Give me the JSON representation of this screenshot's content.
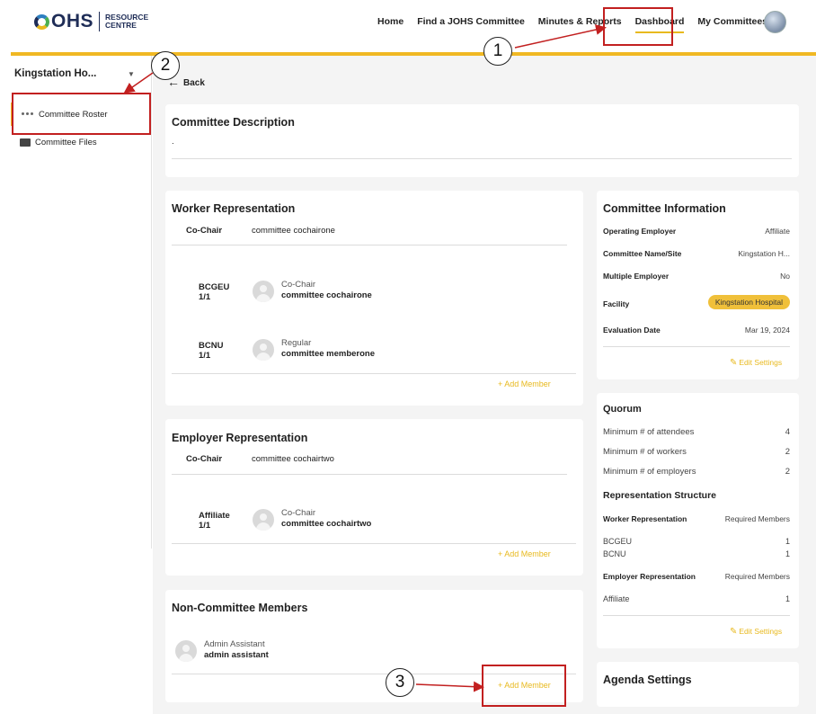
{
  "header": {
    "logo_main": "OHS",
    "logo_sub1": "RESOURCE",
    "logo_sub2": "CENTRE",
    "nav": [
      "Home",
      "Find a JOHS Committee",
      "Minutes & Reports",
      "Dashboard",
      "My Committees"
    ],
    "active_nav": "Dashboard"
  },
  "sidebar": {
    "site_select": "Kingstation Ho...",
    "items": [
      {
        "label": "Committee Roster",
        "icon": "people-icon"
      },
      {
        "label": "Committee Files",
        "icon": "folder-icon"
      }
    ]
  },
  "back_label": "Back",
  "description": {
    "title": "Committee Description",
    "text": "."
  },
  "worker": {
    "title": "Worker Representation",
    "cochair_label": "Co-Chair",
    "cochair_name": "committee cochairone",
    "members": [
      {
        "union": "BCGEU",
        "count": "1/1",
        "role": "Co-Chair",
        "name": "committee cochairone"
      },
      {
        "union": "BCNU",
        "count": "1/1",
        "role": "Regular",
        "name": "committee memberone"
      }
    ],
    "add_member": "+ Add Member"
  },
  "employer": {
    "title": "Employer Representation",
    "cochair_label": "Co-Chair",
    "cochair_name": "committee cochairtwo",
    "members": [
      {
        "union": "Affiliate",
        "count": "1/1",
        "role": "Co-Chair",
        "name": "committee cochairtwo"
      }
    ],
    "add_member": "+ Add Member"
  },
  "non_committee": {
    "title": "Non-Committee Members",
    "members": [
      {
        "role": "Admin Assistant",
        "name": "admin assistant"
      }
    ],
    "add_member": "+ Add Member"
  },
  "committee_info": {
    "title": "Committee Information",
    "rows": [
      {
        "label": "Operating Employer",
        "value": "Affiliate"
      },
      {
        "label": "Committee Name/Site",
        "value": "Kingstation H..."
      },
      {
        "label": "Multiple Employer",
        "value": "No"
      },
      {
        "label": "Facility",
        "value": "Kingstation Hospital"
      },
      {
        "label": "Evaluation Date",
        "value": "Mar 19, 2024"
      }
    ],
    "edit": "Edit Settings"
  },
  "quorum": {
    "title": "Quorum",
    "rows": [
      {
        "label": "Minimum # of attendees",
        "value": "4"
      },
      {
        "label": "Minimum # of workers",
        "value": "2"
      },
      {
        "label": "Minimum # of employers",
        "value": "2"
      }
    ],
    "structure_title": "Representation Structure",
    "worker_rep_label": "Worker Representation",
    "required_label": "Required Members",
    "worker_unions": [
      {
        "name": "BCGEU",
        "value": "1"
      },
      {
        "name": "BCNU",
        "value": "1"
      }
    ],
    "employer_rep_label": "Employer Representation",
    "employer_unions": [
      {
        "name": "Affiliate",
        "value": "1"
      }
    ],
    "edit": "Edit Settings"
  },
  "agenda": {
    "title": "Agenda Settings"
  },
  "callouts": [
    "1",
    "2",
    "3"
  ],
  "colors": {
    "accent": "#f0b823",
    "annotation_red": "#c22020"
  }
}
